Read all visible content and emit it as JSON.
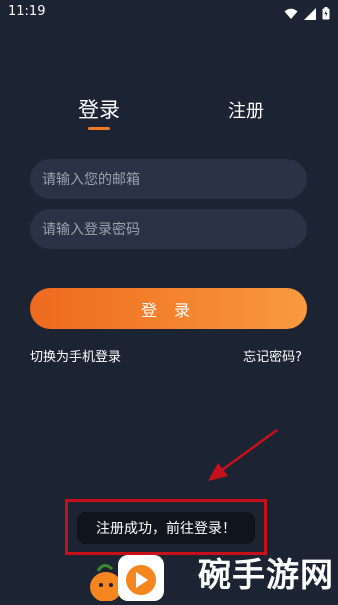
{
  "status_bar": {
    "time": "11:19"
  },
  "tabs": {
    "login": "登录",
    "register": "注册"
  },
  "form": {
    "email_placeholder": "请输入您的邮箱",
    "password_placeholder": "请输入登录密码",
    "login_button": "登 录"
  },
  "links": {
    "phone_login": "切换为手机登录",
    "forgot_password": "忘记密码?"
  },
  "toast": {
    "message": "注册成功，前往登录！"
  },
  "watermark": {
    "site_name": "碗手游网"
  },
  "colors": {
    "accent": "#f07a26",
    "background": "#1c2333",
    "field": "#2a3245",
    "highlight_frame": "#c8101a"
  }
}
